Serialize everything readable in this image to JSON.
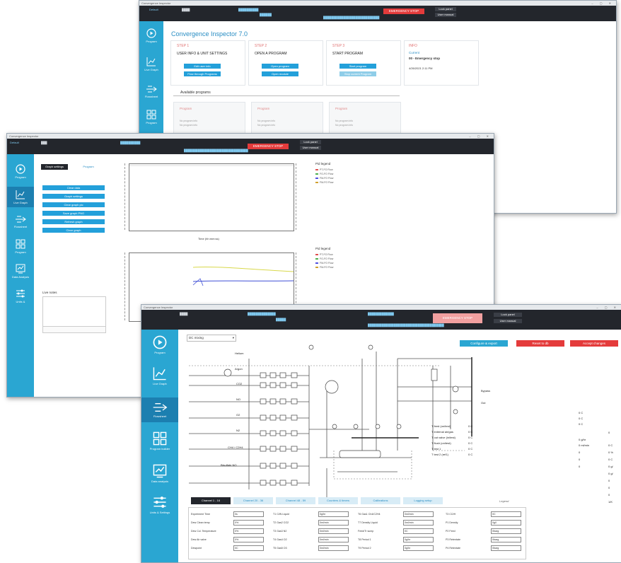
{
  "w1": {
    "title": "Convergence Inspector",
    "header": {
      "user": "Default",
      "emergency": "EMERGENCY STOP",
      "lock_panel": "Lock panel",
      "user_manual": "User manual"
    },
    "app_title": "Convergence Inspector 7.0",
    "sidebar": [
      "Program",
      "Live Graph",
      "Flowsheet",
      "Program"
    ],
    "steps": [
      {
        "step": "STEP 1",
        "desc": "USER INFO & UNIT SETTINGS",
        "b1": "Edit user info",
        "b2": "Flow through Programs"
      },
      {
        "step": "STEP 2",
        "desc": "OPEN A PROGRAM",
        "b1": "Open program",
        "b2": "Open module"
      },
      {
        "step": "STEP 3",
        "desc": "START PROGRAM",
        "b1": "Start program",
        "b2": "Stop current Program"
      }
    ],
    "info": {
      "head": "INFO",
      "sub": "Current",
      "status": "00 - Emergency stop",
      "time": "4/26/2021 2:11 PM"
    },
    "available": "Available programs",
    "programs": [
      "Program",
      "Program",
      "Program"
    ],
    "no_prog": [
      "No program info",
      "No program info"
    ]
  },
  "w2": {
    "title": "Convergence Inspector",
    "header": {
      "user": "Default",
      "emergency": "EMERGENCY STOP",
      "lock_panel": "Lock panel",
      "user_manual": "User manual"
    },
    "sidebar": [
      "Program",
      "Live Graph",
      "Flowsheet",
      "Program",
      "Data Analysis",
      "Units &"
    ],
    "tabs": [
      "Graph settings",
      "Program"
    ],
    "buttons": [
      "Clear data",
      "Graph settings",
      "Clear graph pic",
      "Save graph PNG",
      "Refresh graph",
      "Clear graph"
    ],
    "live_notes": "Live notes",
    "legend1_title": "Pid legend",
    "legend1": [
      "PT-FO Flow",
      "FG-FO Flow",
      "FM-FO Flow",
      "FM-FO Flow"
    ],
    "legend1_colors": [
      "#e05050",
      "#50b050",
      "#5050e0",
      "#d0a030"
    ],
    "legend2_title": "Pid legend",
    "legend2": [
      "PT-FO Flow",
      "FG-FO Flow",
      "FM-FO Flow",
      "FM-FO Flow"
    ],
    "legend2_colors": [
      "#e05050",
      "#50b050",
      "#5050e0",
      "#d0a030"
    ],
    "xlabel": "Time (hh:mm:ss)"
  },
  "w3": {
    "title": "Convergence Inspector",
    "header": {
      "emergency": "EMERGENCY STOP",
      "lock_panel": "Lock panel",
      "user_manual": "User manual"
    },
    "sidebar": [
      "Program",
      "Live Graph",
      "Flowsheet",
      "Program builder",
      "Data analysis",
      "Units & Settings"
    ],
    "dropdown": "DC mixing",
    "actions": {
      "configure": "Configure & export",
      "reset": "Reset to db",
      "accept": "Accept changes"
    },
    "lines": [
      "Helium",
      "Argon",
      "CO2",
      "NO",
      "O2",
      "N2",
      "CH4 / C2H4",
      "Bisulfate NO"
    ],
    "right_labels": [
      "Bypass",
      "Out"
    ],
    "temps": [
      [
        "T feed (on/test)",
        "0 C"
      ],
      [
        "T external air/gas",
        "0 C"
      ],
      [
        "T out valve (in/test)",
        "0 C"
      ],
      [
        "T flush (on/test)",
        "0 C"
      ],
      [
        "T test 1",
        "0 C"
      ],
      [
        "T test 2 (ref1)",
        "0 C"
      ]
    ],
    "right_col1": [
      "0 C",
      "0 C",
      "0 C"
    ],
    "right_col2": [
      "0 g/hr",
      "0 ml/min",
      "0",
      "0",
      "0"
    ],
    "right_col3": [
      "0",
      "0 C",
      "0 %",
      "0 C",
      "0 g/",
      "0 g/",
      "0",
      "0",
      "0",
      "1/K"
    ],
    "tabs": [
      "Channel 1 - 16",
      "Channel 20 - 36",
      "Channel 48 - 59",
      "Counters & timers",
      "Calibrations",
      "Logging setup"
    ],
    "legend_label": "Legend",
    "table": [
      [
        "Experiment Time",
        "0s",
        "T1 Cl/N Liquid",
        "0g/hr",
        "T6 Gas1 Ch4/C2H4",
        "0ml/min",
        "T3 CO/H",
        "0C"
      ],
      [
        "Dew Clean temp",
        "0%",
        "T2 Gas2 CO2",
        "0ml/min",
        "T7 Density Liquid",
        "0ml/min",
        "P1 Density",
        "0g/l"
      ],
      [
        "Dew Col. Temperature",
        "0%",
        "T3 Gas3 N2",
        "0ml/min",
        "Feed/Tr sump",
        "0C",
        "P2 Feed",
        "0barg"
      ],
      [
        "Dew Air valve",
        "0%",
        "T4 Gas4 O2",
        "0ml/min",
        "T8 Period 1",
        "0g/hr",
        "P3 Retentate",
        "0barg"
      ],
      [
        "Dewpoint",
        "0C",
        "T5 Gas5 O3",
        "0ml/min",
        "T9 Period 2",
        "0g/hr",
        "P4 Retentate",
        "0barg"
      ]
    ]
  }
}
